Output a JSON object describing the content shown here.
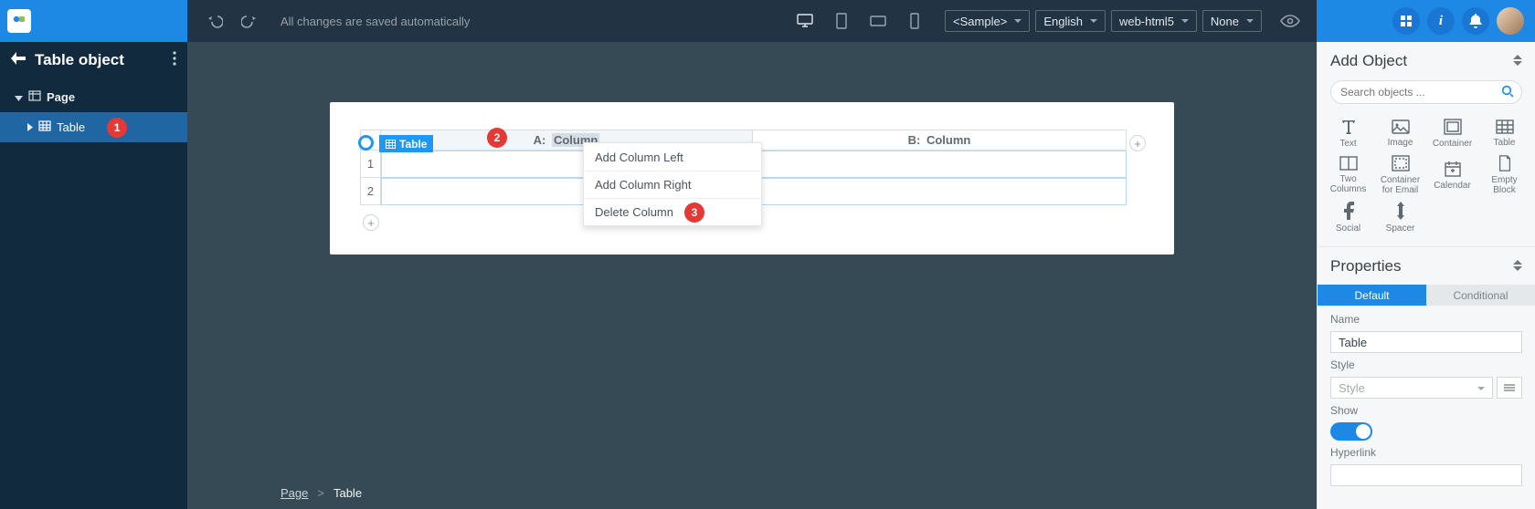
{
  "topbar": {
    "autosave": "All changes are saved automatically",
    "dropdowns": {
      "sample": "<Sample>",
      "language": "English",
      "output": "web-html5",
      "extra": "None"
    }
  },
  "sidebar": {
    "title": "Table object",
    "tree": {
      "page_label": "Page",
      "table_label": "Table"
    },
    "badge1": "1"
  },
  "canvas": {
    "table_tag": "Table",
    "col_a_prefix": "A:",
    "col_a_name": "Column",
    "col_b_prefix": "B:",
    "col_b_name": "Column",
    "row1": "1",
    "row2": "2",
    "badge2": "2",
    "badge3": "3",
    "context_menu": {
      "add_left": "Add Column Left",
      "add_right": "Add Column Right",
      "delete": "Delete Column"
    }
  },
  "breadcrumb": {
    "page": "Page",
    "sep": ">",
    "current": "Table"
  },
  "rightpanel": {
    "add_object_title": "Add Object",
    "search_placeholder": "Search objects ...",
    "objects": {
      "text": "Text",
      "image": "Image",
      "container": "Container",
      "table": "Table",
      "two_columns": "Two Columns",
      "container_email": "Container for Email",
      "calendar": "Calendar",
      "empty_block": "Empty Block",
      "social": "Social",
      "spacer": "Spacer"
    },
    "properties_title": "Properties",
    "tabs": {
      "default": "Default",
      "conditional": "Conditional"
    },
    "name_label": "Name",
    "name_value": "Table",
    "style_label": "Style",
    "style_placeholder": "Style",
    "show_label": "Show",
    "hyperlink_label": "Hyperlink"
  }
}
